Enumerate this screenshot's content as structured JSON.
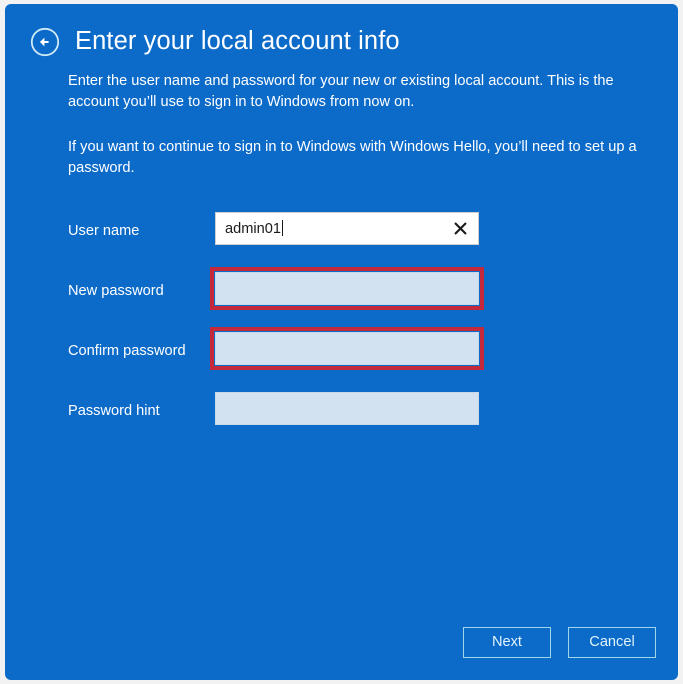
{
  "window": {
    "background_color": "#0c6bc9",
    "page_background": "#f2f2f2"
  },
  "header": {
    "back_icon": "back-arrow-circle-icon",
    "title": "Enter your local account info"
  },
  "intro": {
    "paragraph1": "Enter the user name and password for your new or existing local account. This is the account you’ll use to sign in to Windows from now on.",
    "paragraph2": "If you want to continue to sign in to Windows with Windows Hello, you’ll need to set up a password."
  },
  "form": {
    "fields": [
      {
        "label": "User name",
        "value": "admin01",
        "placeholder": "",
        "type": "text",
        "has_clear_icon": true,
        "clear_icon": "close-x-icon",
        "highlighted": false,
        "focused": true
      },
      {
        "label": "New password",
        "value": "",
        "placeholder": "",
        "type": "password",
        "has_clear_icon": false,
        "highlighted": true,
        "focused": false
      },
      {
        "label": "Confirm password",
        "value": "",
        "placeholder": "",
        "type": "password",
        "has_clear_icon": false,
        "highlighted": true,
        "focused": false
      },
      {
        "label": "Password hint",
        "value": "",
        "placeholder": "",
        "type": "text",
        "has_clear_icon": false,
        "highlighted": false,
        "focused": false
      }
    ],
    "highlight_color": "#c42a3c",
    "empty_field_fill": "#d3e2f0"
  },
  "footer": {
    "next_label": "Next",
    "cancel_label": "Cancel",
    "button_border_color": "#9fd7e8"
  }
}
